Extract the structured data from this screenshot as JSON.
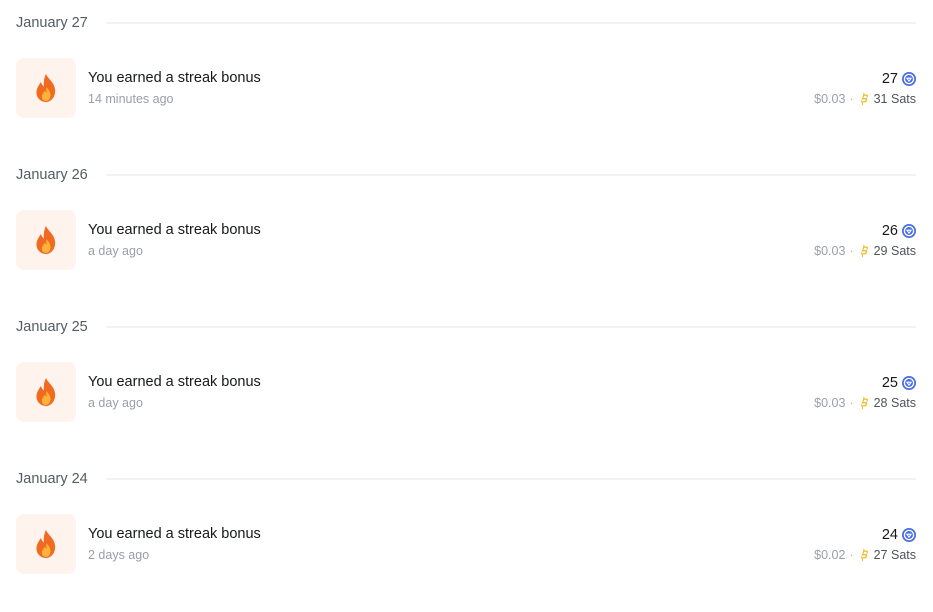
{
  "groups": [
    {
      "date": "January 27",
      "entry": {
        "icon": "flame-icon",
        "title": "You earned a streak bonus",
        "time": "14 minutes ago",
        "points": "27",
        "usd": "$0.03",
        "separator": "·",
        "sats": "31 Sats"
      }
    },
    {
      "date": "January 26",
      "entry": {
        "icon": "flame-icon",
        "title": "You earned a streak bonus",
        "time": "a day ago",
        "points": "26",
        "usd": "$0.03",
        "separator": "·",
        "sats": "29 Sats"
      }
    },
    {
      "date": "January 25",
      "entry": {
        "icon": "flame-icon",
        "title": "You earned a streak bonus",
        "time": "a day ago",
        "points": "25",
        "usd": "$0.03",
        "separator": "·",
        "sats": "28 Sats"
      }
    },
    {
      "date": "January 24",
      "entry": {
        "icon": "flame-icon",
        "title": "You earned a streak bonus",
        "time": "2 days ago",
        "points": "24",
        "usd": "$0.02",
        "separator": "·",
        "sats": "27 Sats"
      }
    }
  ],
  "colors": {
    "badge_bg": "#fff3ee",
    "flame_outer": "#f06a1f",
    "flame_inner": "#ffb23c",
    "coin_blue": "#4a6fe0",
    "bitcoin_gold": "#f2b824",
    "divider": "#f2f2f2"
  }
}
